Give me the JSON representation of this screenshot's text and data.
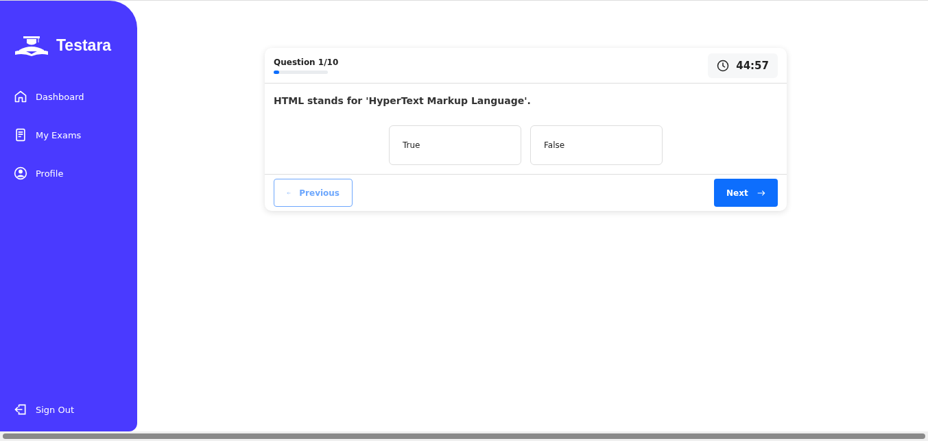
{
  "sidebar": {
    "brand": "Testara",
    "items": [
      {
        "kind": "home",
        "label": "Dashboard"
      },
      {
        "kind": "document",
        "label": "My Exams"
      },
      {
        "kind": "user",
        "label": "Profile"
      }
    ],
    "sign_out": {
      "label": "Sign Out"
    }
  },
  "quiz": {
    "counter": "Question 1/10",
    "progress": {
      "level": 0.1
    },
    "timer": "44:57",
    "question": "HTML stands for 'HyperText Markup Language'.",
    "options": [
      {
        "label": "True",
        "selected": false
      },
      {
        "label": "False",
        "selected": false
      }
    ],
    "previous": {
      "label": "Previous",
      "disabled": true
    },
    "next": {
      "label": "Next",
      "disabled": false
    }
  }
}
